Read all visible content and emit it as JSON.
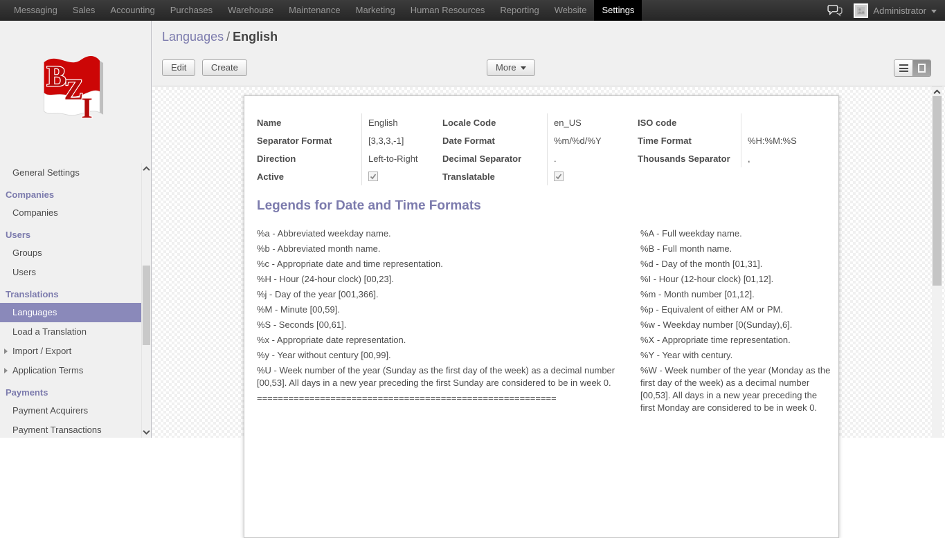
{
  "topbar": {
    "items": [
      "Messaging",
      "Sales",
      "Accounting",
      "Purchases",
      "Warehouse",
      "Maintenance",
      "Marketing",
      "Human Resources",
      "Reporting",
      "Website",
      "Settings"
    ],
    "active_item": "Settings",
    "user_name": "Administrator",
    "icons": {
      "messaging": "chat-bubbles-icon",
      "avatar": "user-avatar",
      "user_menu": "chevron-down-icon"
    }
  },
  "sidebar": {
    "logo_text": "BZI",
    "entries": [
      {
        "type": "item",
        "label": "General Settings"
      },
      {
        "type": "header",
        "label": "Companies"
      },
      {
        "type": "item",
        "label": "Companies"
      },
      {
        "type": "header",
        "label": "Users"
      },
      {
        "type": "item",
        "label": "Groups"
      },
      {
        "type": "item",
        "label": "Users"
      },
      {
        "type": "header",
        "label": "Translations"
      },
      {
        "type": "item",
        "label": "Languages",
        "selected": true
      },
      {
        "type": "item",
        "label": "Load a Translation"
      },
      {
        "type": "item",
        "label": "Import / Export",
        "expandable": true
      },
      {
        "type": "item",
        "label": "Application Terms",
        "expandable": true
      },
      {
        "type": "header",
        "label": "Payments"
      },
      {
        "type": "item",
        "label": "Payment Acquirers"
      },
      {
        "type": "item",
        "label": "Payment Transactions"
      }
    ]
  },
  "breadcrumb": {
    "section": "Languages",
    "separator": "/",
    "current": "English"
  },
  "toolbar": {
    "edit_label": "Edit",
    "create_label": "Create",
    "more_label": "More",
    "views": [
      "list",
      "form"
    ],
    "active_view": "form"
  },
  "form": {
    "groups": [
      {
        "rows": [
          {
            "label": "Name",
            "value": "English"
          },
          {
            "label": "Separator Format",
            "value": "[3,3,3,-1]"
          },
          {
            "label": "Direction",
            "value": "Left-to-Right"
          },
          {
            "label": "Active",
            "checked": true
          }
        ]
      },
      {
        "rows": [
          {
            "label": "Locale Code",
            "value": "en_US"
          },
          {
            "label": "Date Format",
            "value": "%m/%d/%Y"
          },
          {
            "label": "Decimal Separator",
            "value": "."
          },
          {
            "label": "Translatable",
            "checked": true
          }
        ]
      },
      {
        "rows": [
          {
            "label": "ISO code",
            "value": ""
          },
          {
            "label": "Time Format",
            "value": "%H:%M:%S"
          },
          {
            "label": "Thousands Separator",
            "value": ","
          }
        ]
      }
    ]
  },
  "legend": {
    "title": "Legends for Date and Time Formats",
    "left": [
      "%a - Abbreviated weekday name.",
      "%b - Abbreviated month name.",
      "%c - Appropriate date and time representation.",
      "%H - Hour (24-hour clock) [00,23].",
      "%j - Day of the year [001,366].",
      "%M - Minute [00,59].",
      "%S - Seconds [00,61].",
      "%x - Appropriate date representation.",
      "%y - Year without century [00,99].",
      "%U - Week number of the year (Sunday as the first day of the week) as a decimal number [00,53]. All days in a new year preceding the first Sunday are considered to be in week 0."
    ],
    "right": [
      "%A - Full weekday name.",
      "%B - Full month name.",
      "%d - Day of the month [01,31].",
      "%I - Hour (12-hour clock) [01,12].",
      "%m - Month number [01,12].",
      "%p - Equivalent of either AM or PM.",
      "%w - Weekday number [0(Sunday),6].",
      "%X - Appropriate time representation.",
      "%Y - Year with century.",
      "%W - Week number of the year (Monday as the first day of the week) as a decimal number [00,53]. All days in a new year preceding the first Monday are considered to be in week 0."
    ],
    "separator": "========================================================="
  },
  "colors": {
    "accent": "#7c7bad",
    "selected_item_bg": "#8a89ba",
    "topbar_active_bg": "#000000",
    "topbar_bg": "#2e2e2e"
  }
}
